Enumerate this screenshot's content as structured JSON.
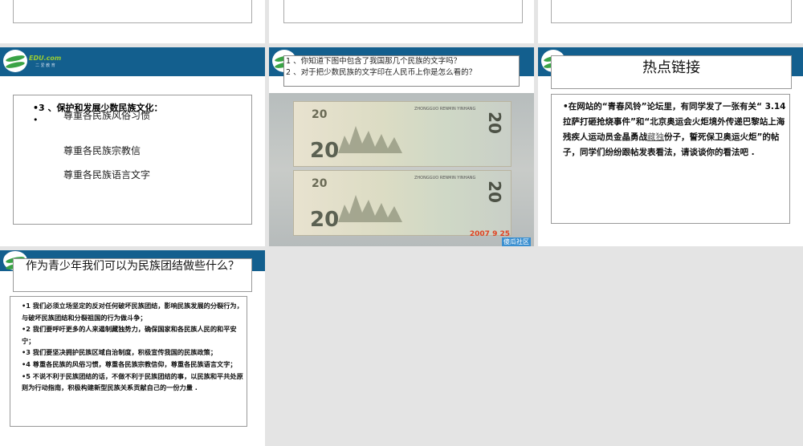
{
  "logo": {
    "text": "EDU.com",
    "sub": "二 爱 教 育"
  },
  "slide_a": {
    "heading": "•3 、保护和发展少数民族文化：",
    "bullet": "•",
    "items": [
      "尊重各民族风俗习惯",
      "尊重各民族宗教信",
      "尊重各民族语言文字"
    ]
  },
  "slide_b": {
    "q1": "1 、你知道下图中包含了我国那几个民族的文字吗？",
    "q2": "2 、对于把少数民族的文字印在人民币上你是怎么看的？",
    "note_header": "ZHONGGUO RENMIN YINHANG",
    "denomination": "20",
    "serial": "2007  9  25",
    "watermark": "傻瓜社区"
  },
  "slide_c": {
    "title": "热点链接",
    "body_pre": "•在网站的“青春风铃”论坛里，有同学发了一张有关“ 3.14 拉萨打砸抢烧事件”和“北京奥运会火炬境外传递巴黎站上海残疾人运动员金晶勇战",
    "body_link": "藏独",
    "body_post": "份子，誓死保卫奥运火炬”的帖子，同学们纷纷跟帖发表看法，请谈谈你的看法吧 ."
  },
  "slide_d": {
    "title": "作为青少年我们可以为民族团结做些什么？",
    "points": [
      "•1  我们必须立场坚定的反对任何破坏民族团结，影响民族发展的分裂行为，与破坏民族团结和分裂祖国的行为做斗争；",
      "•2 我们要呼吁更多的人来遏制藏独势力，确保国家和各民族人民的和平安宁；",
      "•3 我们要坚决拥护民族区域自治制度，积极宣传我国的民族政策；",
      "•4 尊重各民族的风俗习惯，尊重各民族宗教信仰，尊重各民族语言文字；",
      "•5 不说不利于民族团结的话，不做不利于民族团结的事，以民族和平共处原则为行动指南，积极构建新型民族关系贡献自己的一份力量 ."
    ]
  }
}
